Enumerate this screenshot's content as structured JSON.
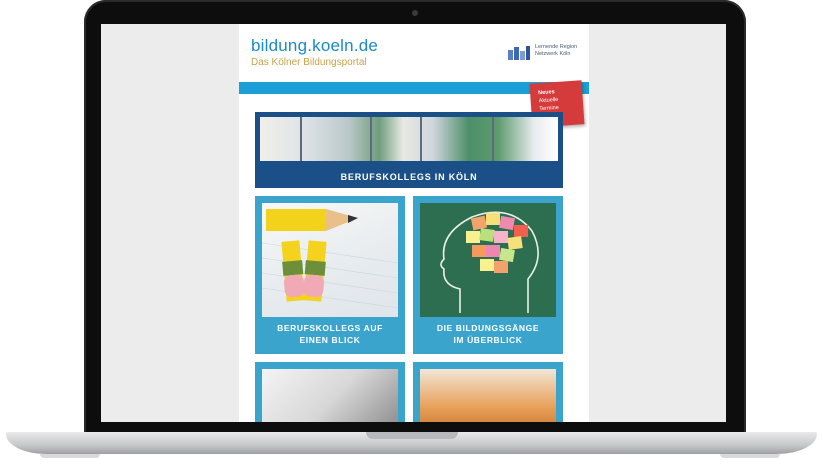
{
  "site": {
    "logo": "bildung.koeln.de",
    "tagline": "Das Kölner Bildungsportal",
    "partner": [
      "Lernende Region",
      "Netzwerk Köln"
    ],
    "sticky_note": [
      "Neues",
      "Aktuelle",
      "Termine"
    ]
  },
  "banner": {
    "label": "BERUFSKOLLEGS IN KÖLN"
  },
  "tiles": [
    {
      "label_line1": "BERUFSKOLLEGS AUF",
      "label_line2": "EINEN BLICK"
    },
    {
      "label_line1": "DIE BILDUNGSGÄNGE",
      "label_line2": "IM ÜBERBLICK"
    }
  ],
  "colors": {
    "accent_blue": "#1a9fd6",
    "banner_navy": "#1b4f87",
    "tile_cyan": "#3aa4cc",
    "sticky_red": "#d63b3b"
  }
}
